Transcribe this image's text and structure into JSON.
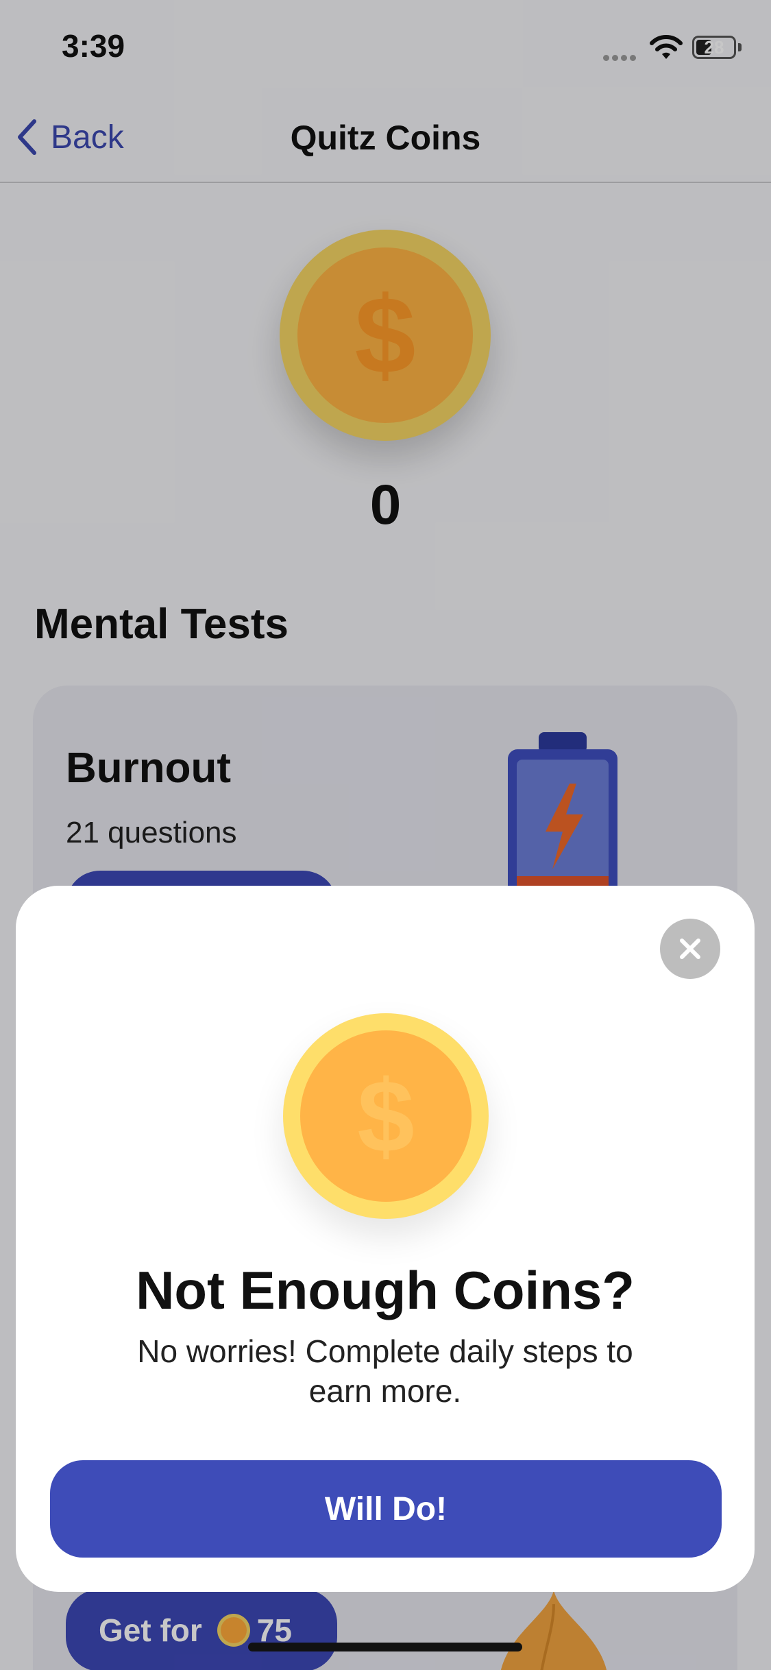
{
  "status_bar": {
    "time": "3:39",
    "battery": "28"
  },
  "nav": {
    "back_label": "Back",
    "title": "Quitz Coins"
  },
  "coins": {
    "balance": "0",
    "icon": "dollar-coin-icon",
    "symbol": "$"
  },
  "section": {
    "title": "Mental Tests"
  },
  "test_card": {
    "title": "Burnout",
    "questions": "21 questions",
    "illustration": "battery-charging-icon"
  },
  "next_card": {
    "get_label": "Get for",
    "price": "75",
    "illustration": "onion-icon"
  },
  "modal": {
    "title": "Not Enough Coins?",
    "body": "No worries! Complete daily steps to earn more.",
    "button": "Will Do!",
    "close_icon": "close-icon"
  },
  "colors": {
    "accent": "#3e4cb8",
    "coin_outer": "#fede6a",
    "coin_inner": "#ffb447",
    "close_button": "#bdbdbd"
  }
}
